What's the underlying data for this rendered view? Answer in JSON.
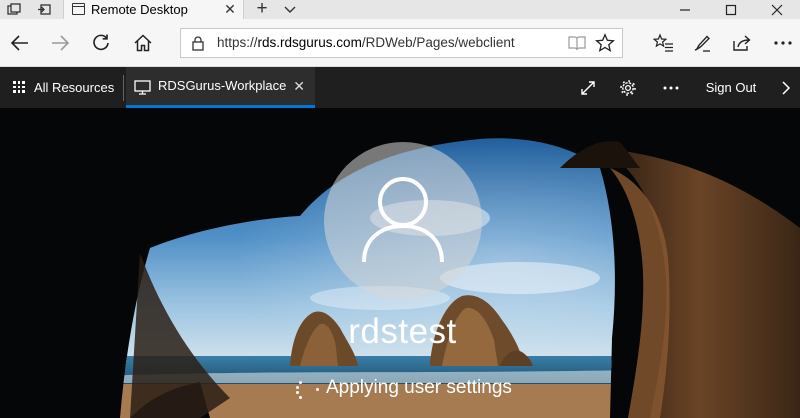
{
  "browser": {
    "tab_title": "Remote Desktop",
    "address_scheme": "https://",
    "address_host": "rds.rdsgurus.com",
    "address_path": "/RDWeb/Pages/webclient"
  },
  "rdclient": {
    "all_resources_label": "All Resources",
    "session_label": "RDSGurus-Workplace",
    "sign_out_label": "Sign Out",
    "accent_color": "#0078d7"
  },
  "lockscreen": {
    "username": "rdstest",
    "status": "Applying user settings"
  }
}
